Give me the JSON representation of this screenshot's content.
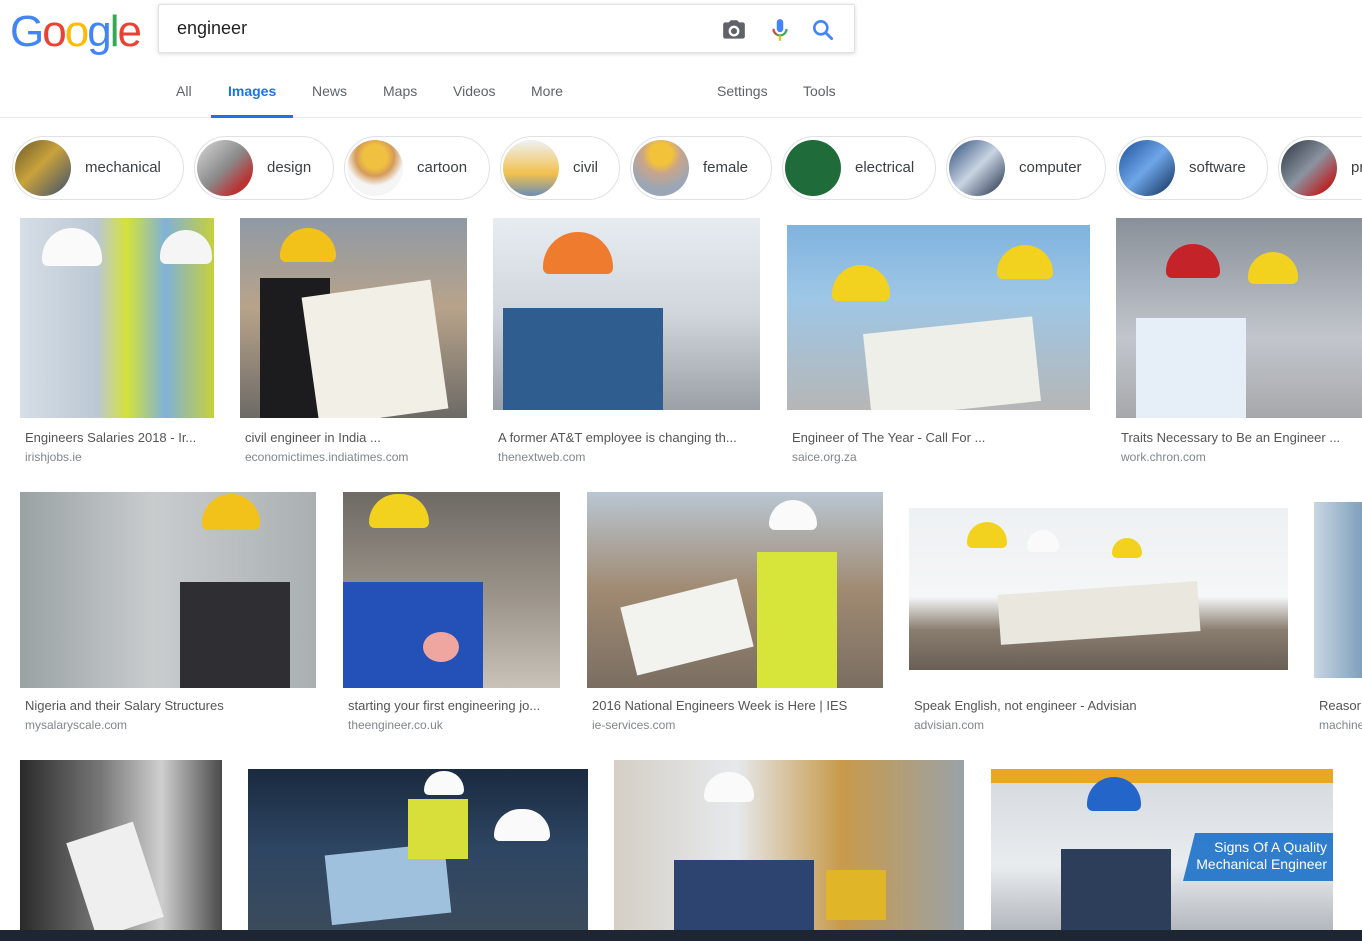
{
  "query": "engineer",
  "tabs": [
    {
      "label": "All"
    },
    {
      "label": "Images"
    },
    {
      "label": "News"
    },
    {
      "label": "Maps"
    },
    {
      "label": "Videos"
    },
    {
      "label": "More"
    },
    {
      "label": "Settings"
    },
    {
      "label": "Tools"
    }
  ],
  "chips": [
    {
      "label": "mechanical"
    },
    {
      "label": "design"
    },
    {
      "label": "cartoon"
    },
    {
      "label": "civil"
    },
    {
      "label": "female"
    },
    {
      "label": "electrical"
    },
    {
      "label": "computer"
    },
    {
      "label": "software"
    },
    {
      "label": "pr"
    }
  ],
  "results": [
    {
      "title": "Engineers Salaries 2018 - Ir...",
      "source": "irishjobs.ie"
    },
    {
      "title": "civil engineer in India ...",
      "source": "economictimes.indiatimes.com"
    },
    {
      "title": "A former AT&T employee is changing th...",
      "source": "thenextweb.com"
    },
    {
      "title": "Engineer of The Year - Call For ...",
      "source": "saice.org.za"
    },
    {
      "title": "Traits Necessary to Be an Engineer ...",
      "source": "work.chron.com"
    },
    {
      "title": "Nigeria and their Salary Structures",
      "source": "mysalaryscale.com"
    },
    {
      "title": "starting your first engineering jo...",
      "source": "theengineer.co.uk"
    },
    {
      "title": "2016 National Engineers Week is Here | IES",
      "source": "ie-services.com"
    },
    {
      "title": "Speak English, not engineer - Advisian",
      "source": "advisian.com"
    },
    {
      "title": "Reasor",
      "source": "machine"
    }
  ],
  "overlay": {
    "line1": "Signs Of A Quality",
    "line2": "Mechanical Engineer"
  },
  "colors": {
    "accent": "#1a73e8",
    "text": "#222222",
    "muted": "#80868b"
  }
}
